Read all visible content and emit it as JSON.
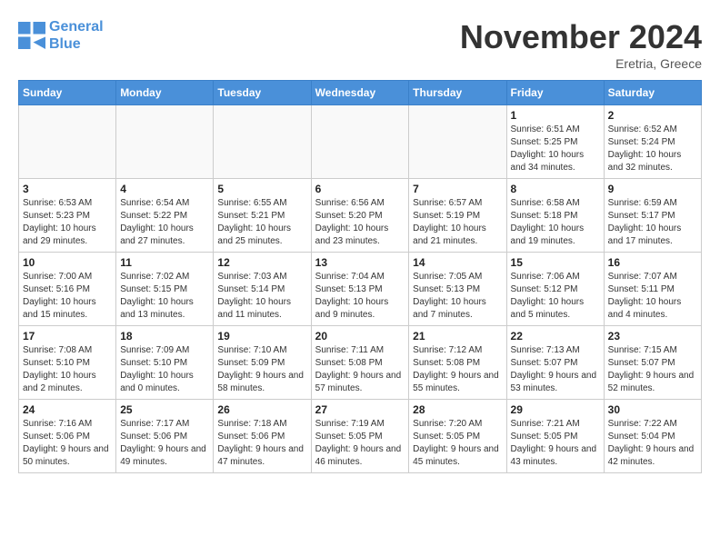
{
  "logo": {
    "line1": "General",
    "line2": "Blue"
  },
  "title": "November 2024",
  "subtitle": "Eretria, Greece",
  "days_header": [
    "Sunday",
    "Monday",
    "Tuesday",
    "Wednesday",
    "Thursday",
    "Friday",
    "Saturday"
  ],
  "weeks": [
    [
      {
        "day": "",
        "detail": ""
      },
      {
        "day": "",
        "detail": ""
      },
      {
        "day": "",
        "detail": ""
      },
      {
        "day": "",
        "detail": ""
      },
      {
        "day": "",
        "detail": ""
      },
      {
        "day": "1",
        "detail": "Sunrise: 6:51 AM\nSunset: 5:25 PM\nDaylight: 10 hours\nand 34 minutes."
      },
      {
        "day": "2",
        "detail": "Sunrise: 6:52 AM\nSunset: 5:24 PM\nDaylight: 10 hours\nand 32 minutes."
      }
    ],
    [
      {
        "day": "3",
        "detail": "Sunrise: 6:53 AM\nSunset: 5:23 PM\nDaylight: 10 hours\nand 29 minutes."
      },
      {
        "day": "4",
        "detail": "Sunrise: 6:54 AM\nSunset: 5:22 PM\nDaylight: 10 hours\nand 27 minutes."
      },
      {
        "day": "5",
        "detail": "Sunrise: 6:55 AM\nSunset: 5:21 PM\nDaylight: 10 hours\nand 25 minutes."
      },
      {
        "day": "6",
        "detail": "Sunrise: 6:56 AM\nSunset: 5:20 PM\nDaylight: 10 hours\nand 23 minutes."
      },
      {
        "day": "7",
        "detail": "Sunrise: 6:57 AM\nSunset: 5:19 PM\nDaylight: 10 hours\nand 21 minutes."
      },
      {
        "day": "8",
        "detail": "Sunrise: 6:58 AM\nSunset: 5:18 PM\nDaylight: 10 hours\nand 19 minutes."
      },
      {
        "day": "9",
        "detail": "Sunrise: 6:59 AM\nSunset: 5:17 PM\nDaylight: 10 hours\nand 17 minutes."
      }
    ],
    [
      {
        "day": "10",
        "detail": "Sunrise: 7:00 AM\nSunset: 5:16 PM\nDaylight: 10 hours\nand 15 minutes."
      },
      {
        "day": "11",
        "detail": "Sunrise: 7:02 AM\nSunset: 5:15 PM\nDaylight: 10 hours\nand 13 minutes."
      },
      {
        "day": "12",
        "detail": "Sunrise: 7:03 AM\nSunset: 5:14 PM\nDaylight: 10 hours\nand 11 minutes."
      },
      {
        "day": "13",
        "detail": "Sunrise: 7:04 AM\nSunset: 5:13 PM\nDaylight: 10 hours\nand 9 minutes."
      },
      {
        "day": "14",
        "detail": "Sunrise: 7:05 AM\nSunset: 5:13 PM\nDaylight: 10 hours\nand 7 minutes."
      },
      {
        "day": "15",
        "detail": "Sunrise: 7:06 AM\nSunset: 5:12 PM\nDaylight: 10 hours\nand 5 minutes."
      },
      {
        "day": "16",
        "detail": "Sunrise: 7:07 AM\nSunset: 5:11 PM\nDaylight: 10 hours\nand 4 minutes."
      }
    ],
    [
      {
        "day": "17",
        "detail": "Sunrise: 7:08 AM\nSunset: 5:10 PM\nDaylight: 10 hours\nand 2 minutes."
      },
      {
        "day": "18",
        "detail": "Sunrise: 7:09 AM\nSunset: 5:10 PM\nDaylight: 10 hours\nand 0 minutes."
      },
      {
        "day": "19",
        "detail": "Sunrise: 7:10 AM\nSunset: 5:09 PM\nDaylight: 9 hours\nand 58 minutes."
      },
      {
        "day": "20",
        "detail": "Sunrise: 7:11 AM\nSunset: 5:08 PM\nDaylight: 9 hours\nand 57 minutes."
      },
      {
        "day": "21",
        "detail": "Sunrise: 7:12 AM\nSunset: 5:08 PM\nDaylight: 9 hours\nand 55 minutes."
      },
      {
        "day": "22",
        "detail": "Sunrise: 7:13 AM\nSunset: 5:07 PM\nDaylight: 9 hours\nand 53 minutes."
      },
      {
        "day": "23",
        "detail": "Sunrise: 7:15 AM\nSunset: 5:07 PM\nDaylight: 9 hours\nand 52 minutes."
      }
    ],
    [
      {
        "day": "24",
        "detail": "Sunrise: 7:16 AM\nSunset: 5:06 PM\nDaylight: 9 hours\nand 50 minutes."
      },
      {
        "day": "25",
        "detail": "Sunrise: 7:17 AM\nSunset: 5:06 PM\nDaylight: 9 hours\nand 49 minutes."
      },
      {
        "day": "26",
        "detail": "Sunrise: 7:18 AM\nSunset: 5:06 PM\nDaylight: 9 hours\nand 47 minutes."
      },
      {
        "day": "27",
        "detail": "Sunrise: 7:19 AM\nSunset: 5:05 PM\nDaylight: 9 hours\nand 46 minutes."
      },
      {
        "day": "28",
        "detail": "Sunrise: 7:20 AM\nSunset: 5:05 PM\nDaylight: 9 hours\nand 45 minutes."
      },
      {
        "day": "29",
        "detail": "Sunrise: 7:21 AM\nSunset: 5:05 PM\nDaylight: 9 hours\nand 43 minutes."
      },
      {
        "day": "30",
        "detail": "Sunrise: 7:22 AM\nSunset: 5:04 PM\nDaylight: 9 hours\nand 42 minutes."
      }
    ]
  ]
}
